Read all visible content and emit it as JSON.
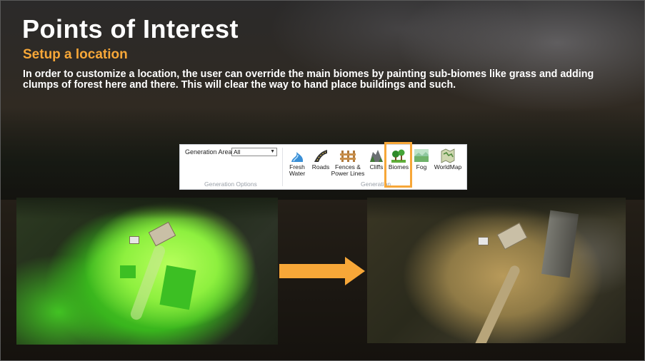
{
  "slide": {
    "title": "Points of Interest",
    "subtitle": "Setup a location",
    "description": "In order to customize a location, the user can override the main biomes by painting sub-biomes like grass and adding clumps of forest here and there. This will clear the way to hand place buildings and such."
  },
  "ribbon": {
    "generation_area_label": "Generation Area",
    "generation_area_value": "All",
    "generation_options_group": "Generation Options",
    "generation_group": "Generation",
    "buttons": [
      {
        "label_lines": [
          "Fresh",
          "Water"
        ],
        "icon": "fresh-water-icon"
      },
      {
        "label_lines": [
          "Roads"
        ],
        "icon": "roads-icon"
      },
      {
        "label_lines": [
          "Fences &",
          "Power Lines"
        ],
        "icon": "fences-icon"
      },
      {
        "label_lines": [
          "Cliffs"
        ],
        "icon": "cliffs-icon"
      },
      {
        "label_lines": [
          "Biomes"
        ],
        "icon": "biomes-icon"
      },
      {
        "label_lines": [
          "Fog"
        ],
        "icon": "fog-icon"
      },
      {
        "label_lines": [
          "WorldMap"
        ],
        "icon": "worldmap-icon"
      }
    ],
    "highlighted_button": "Biomes"
  },
  "colors": {
    "accent": "#f7a738",
    "title": "#ffffff",
    "painted_biome": "#8ef03f"
  },
  "images": {
    "before": "painted-biome-map",
    "after": "rendered-terrain"
  }
}
